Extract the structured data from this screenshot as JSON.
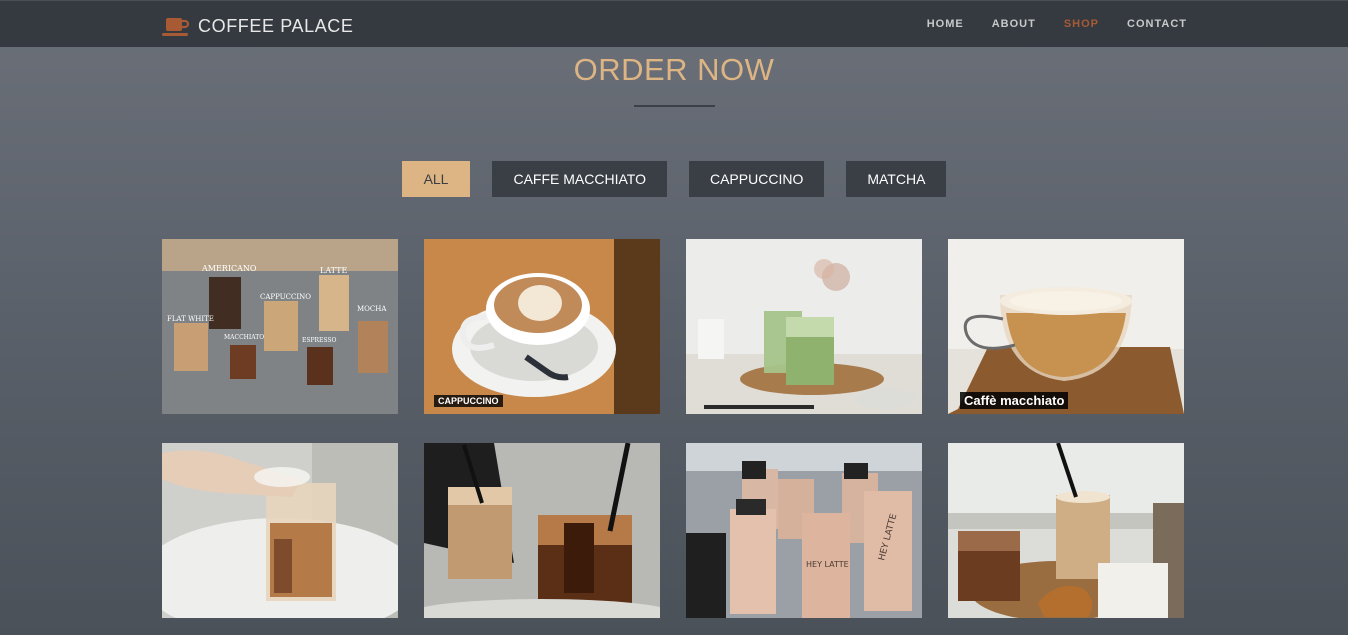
{
  "brand": {
    "name": "COFFEE PALACE",
    "icon": "coffee-cup-icon",
    "accent": "#a85a35"
  },
  "nav": {
    "items": [
      {
        "label": "HOME",
        "active": false
      },
      {
        "label": "ABOUT",
        "active": false
      },
      {
        "label": "SHOP",
        "active": true
      },
      {
        "label": "CONTACT",
        "active": false
      }
    ]
  },
  "section": {
    "title": "ORDER NOW",
    "title_color": "#ddb483"
  },
  "filters": [
    {
      "label": "ALL",
      "active": true
    },
    {
      "label": "CAFFE MACCHIATO",
      "active": false
    },
    {
      "label": "CAPPUCCINO",
      "active": false
    },
    {
      "label": "MATCHA",
      "active": false
    }
  ],
  "gallery": [
    {
      "name": "coffee-types-chart",
      "labels": [
        "AMERICANO",
        "LATTE",
        "FLAT WHITE",
        "CAPPUCCINO",
        "MOCHA",
        "MACCHIATO",
        "ESPRESSO"
      ],
      "caption": ""
    },
    {
      "name": "cappuccino-latte-art",
      "caption": "CAPPUCCINO"
    },
    {
      "name": "matcha-latte-glasses",
      "caption": ""
    },
    {
      "name": "caffe-macchiato-glass",
      "caption": "Caffè macchiato"
    },
    {
      "name": "iced-latte-pour",
      "caption": ""
    },
    {
      "name": "iced-coffee-cups",
      "caption": ""
    },
    {
      "name": "bottled-latte-ice",
      "labels": [
        "HEY LATTE",
        "HEY LATTE"
      ],
      "caption": ""
    },
    {
      "name": "coffee-and-croissant",
      "caption": ""
    }
  ]
}
